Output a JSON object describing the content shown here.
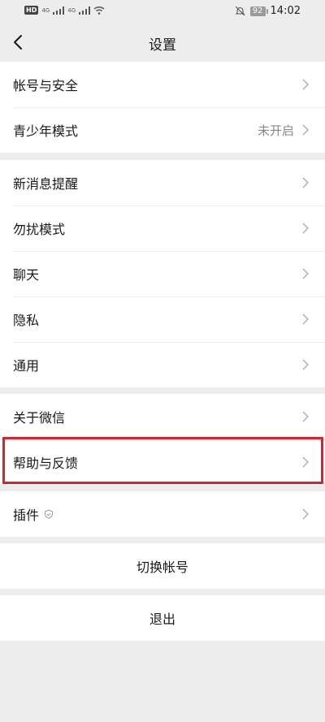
{
  "status_bar": {
    "hd": "HD",
    "signal1": "4G",
    "signal2": "4G",
    "battery": "92",
    "time": "14:02"
  },
  "header": {
    "title": "设置"
  },
  "groups": [
    {
      "items": [
        {
          "label": "帐号与安全"
        },
        {
          "label": "青少年模式",
          "value": "未开启"
        }
      ]
    },
    {
      "items": [
        {
          "label": "新消息提醒"
        },
        {
          "label": "勿扰模式"
        },
        {
          "label": "聊天"
        },
        {
          "label": "隐私"
        },
        {
          "label": "通用"
        }
      ]
    },
    {
      "items": [
        {
          "label": "关于微信"
        },
        {
          "label": "帮助与反馈"
        }
      ]
    },
    {
      "items": [
        {
          "label": "插件",
          "icon": "shield-icon"
        }
      ]
    }
  ],
  "actions": {
    "switch_account": "切换帐号",
    "logout": "退出"
  },
  "colors": {
    "background": "#ededed",
    "highlight": "#e0202a"
  }
}
